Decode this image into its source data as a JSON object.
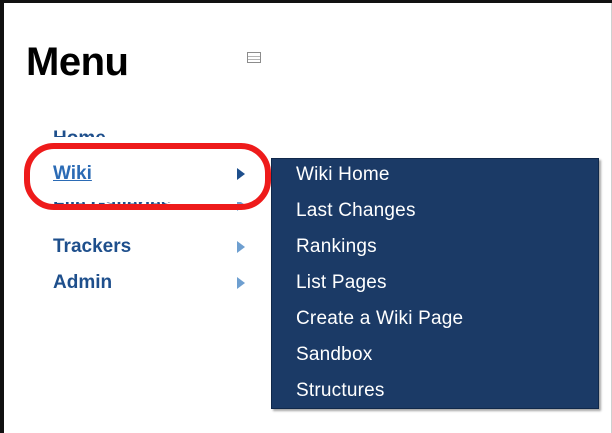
{
  "menu": {
    "title": "Menu",
    "toggle_icon": "collapse-toggle-icon",
    "items": [
      {
        "label": "Home",
        "has_submenu": false,
        "active": false
      },
      {
        "label": "Wiki",
        "has_submenu": true,
        "active": true
      },
      {
        "label": "File Galleries",
        "has_submenu": true,
        "active": false
      },
      {
        "label": "Trackers",
        "has_submenu": true,
        "active": false
      },
      {
        "label": "Admin",
        "has_submenu": true,
        "active": false
      }
    ]
  },
  "submenu": {
    "parent": "Wiki",
    "items": [
      {
        "label": "Wiki Home"
      },
      {
        "label": "Last Changes"
      },
      {
        "label": "Rankings"
      },
      {
        "label": "List Pages"
      },
      {
        "label": "Create a Wiki Page"
      },
      {
        "label": "Sandbox"
      },
      {
        "label": "Structures"
      }
    ]
  },
  "annotation": {
    "highlight_target": "Wiki",
    "highlight_color": "#ee1b1b"
  },
  "colors": {
    "link": "#1e4f8c",
    "link_active": "#2b6bb5",
    "submenu_bg": "#1b3a66",
    "submenu_text": "#ffffff",
    "arrow": "#6e9fd0"
  }
}
